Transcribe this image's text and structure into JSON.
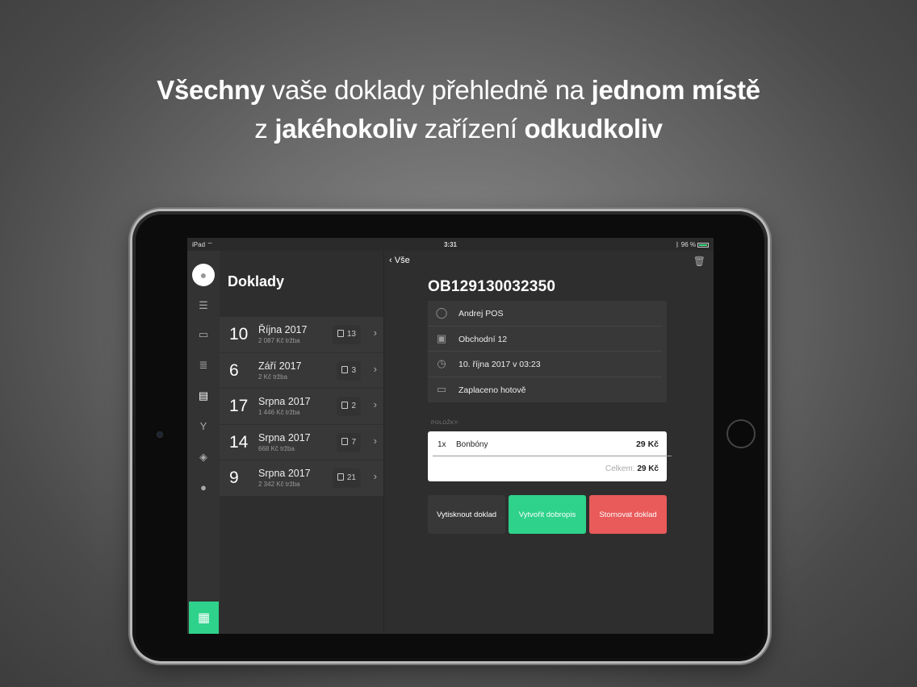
{
  "headline": {
    "line1": [
      {
        "text": "Všechny",
        "bold": true
      },
      {
        "text": " vaše doklady přehledně na ",
        "bold": false
      },
      {
        "text": "jednom místě",
        "bold": true
      }
    ],
    "line2": [
      {
        "text": "z ",
        "bold": false
      },
      {
        "text": "jakéhokoliv",
        "bold": true
      },
      {
        "text": " zařízení ",
        "bold": false
      },
      {
        "text": "odkudkoliv",
        "bold": true
      }
    ]
  },
  "statusbar": {
    "device": "iPad",
    "time": "3:31",
    "battery": "96 %"
  },
  "rail": {
    "icons": [
      "menu-icon",
      "book-icon",
      "list-icon",
      "document-icon",
      "cocktail-icon",
      "box-icon",
      "user-icon"
    ],
    "active_index": 3,
    "store_icon": "store-icon"
  },
  "list": {
    "title": "Doklady",
    "rows": [
      {
        "day": "10",
        "month": "Října 2017",
        "revenue": "2 087 Kč tržba",
        "count": "13"
      },
      {
        "day": "6",
        "month": "Září 2017",
        "revenue": "2 Kč tržba",
        "count": "3"
      },
      {
        "day": "17",
        "month": "Srpna 2017",
        "revenue": "1 446 Kč tržba",
        "count": "2"
      },
      {
        "day": "14",
        "month": "Srpna 2017",
        "revenue": "668 Kč tržba",
        "count": "7"
      },
      {
        "day": "9",
        "month": "Srpna 2017",
        "revenue": "2 342 Kč tržba",
        "count": "21"
      }
    ]
  },
  "detail": {
    "back_label": "Vše",
    "doc_id": "OB129130032350",
    "info": [
      {
        "icon": "user-icon",
        "text": "Andrej POS"
      },
      {
        "icon": "shop-icon",
        "text": "Obchodní 12"
      },
      {
        "icon": "clock-icon",
        "text": "10. října 2017 v 03:23"
      },
      {
        "icon": "wallet-icon",
        "text": "Zaplaceno hotově"
      }
    ],
    "items_label": "POLOŽKY:",
    "item": {
      "qty": "1x",
      "name": "Bonbóny",
      "price": "29 Kč"
    },
    "total_label": "Celkem:",
    "total_value": "29 Kč",
    "buttons": {
      "print": "Vytisknout doklad",
      "credit": "Vytvořit dobropis",
      "cancel": "Stornovat doklad"
    },
    "colors": {
      "green": "#2ed28b",
      "red": "#e95a5a"
    }
  }
}
